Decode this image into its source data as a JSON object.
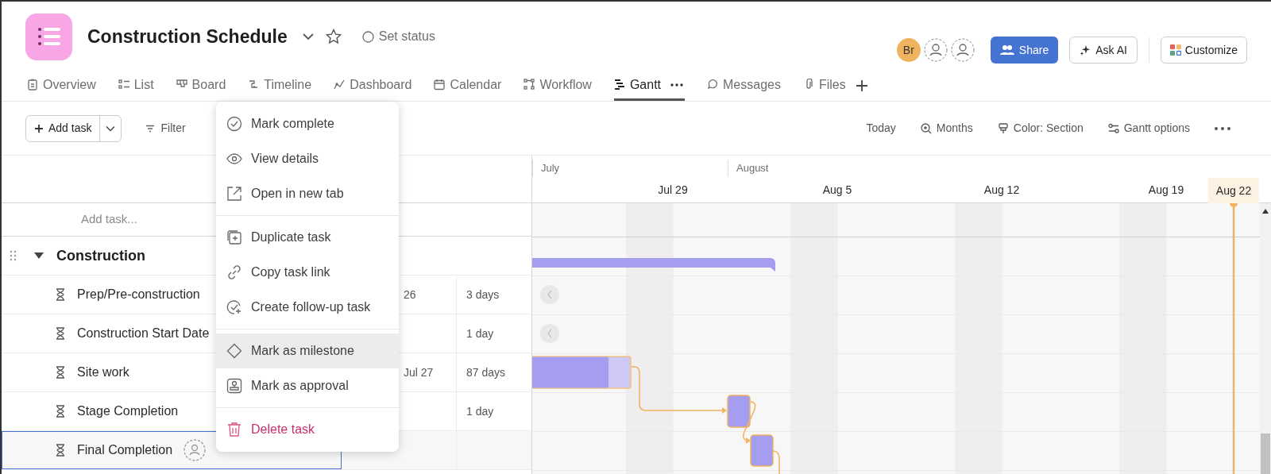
{
  "project": {
    "title": "Construction Schedule",
    "status": "Set status",
    "avatar": "Br"
  },
  "header_buttons": [
    {
      "kind": "share",
      "label": "Share"
    },
    {
      "kind": "ai",
      "label": "Ask AI"
    },
    {
      "kind": "customize",
      "label": "Customize"
    }
  ],
  "tabs": [
    {
      "label": "Overview",
      "selected": false
    },
    {
      "label": "List",
      "selected": false
    },
    {
      "label": "Board",
      "selected": false
    },
    {
      "label": "Timeline",
      "selected": false
    },
    {
      "label": "Dashboard",
      "selected": false
    },
    {
      "label": "Calendar",
      "selected": false
    },
    {
      "label": "Workflow",
      "selected": false
    },
    {
      "label": "Gantt",
      "selected": true
    },
    {
      "label": "Messages",
      "selected": false
    },
    {
      "label": "Files",
      "selected": false
    }
  ],
  "toolbar": {
    "add_task": "Add task",
    "filter": "Filter",
    "right": [
      "Today",
      "Months",
      "Color: Section",
      "Gantt options"
    ]
  },
  "context_menu": [
    [
      {
        "label": "Mark complete",
        "kind": "normal",
        "highlighted": false
      },
      {
        "label": "View details",
        "kind": "normal",
        "highlighted": false
      },
      {
        "label": "Open in new tab",
        "kind": "normal",
        "highlighted": false
      }
    ],
    [
      {
        "label": "Duplicate task",
        "kind": "normal",
        "highlighted": false
      },
      {
        "label": "Copy task link",
        "kind": "normal",
        "highlighted": false
      },
      {
        "label": "Create follow-up task",
        "kind": "normal",
        "highlighted": false
      }
    ],
    [
      {
        "label": "Mark as milestone",
        "kind": "normal",
        "highlighted": true
      },
      {
        "label": "Mark as approval",
        "kind": "normal",
        "highlighted": false
      }
    ],
    [
      {
        "label": "Delete task",
        "kind": "danger",
        "highlighted": false
      }
    ]
  ],
  "task_list": {
    "add_placeholder": "Add task...",
    "section": {
      "name": "Construction",
      "expanded": true
    },
    "rows": [
      {
        "name": "Prep/Pre-construction",
        "date": "26",
        "duration": "3 days",
        "selected": false
      },
      {
        "name": "Construction Start Date",
        "duration": "1 day",
        "selected": false
      },
      {
        "name": "Site work",
        "date": "Jul 27",
        "duration": "87 days",
        "selected": false
      },
      {
        "name": "Stage Completion",
        "duration": "1 day",
        "selected": false
      },
      {
        "name": "Final Completion",
        "selected": true
      }
    ]
  },
  "timeline": {
    "months": [
      "July",
      "August"
    ],
    "weeks": [
      "Jul 29",
      "Aug 5",
      "Aug 12",
      "Aug 19"
    ],
    "today": "Aug 22"
  }
}
